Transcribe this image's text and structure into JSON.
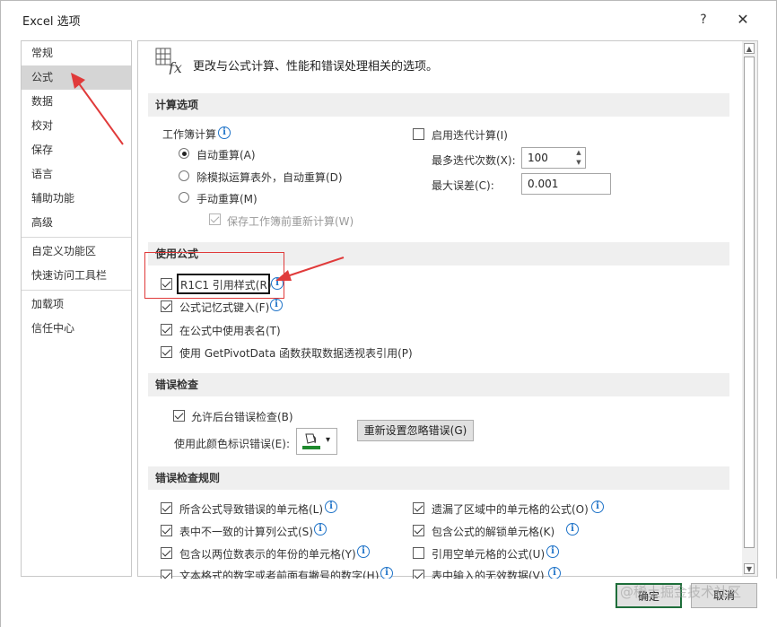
{
  "window": {
    "title": "Excel 选项",
    "help_label": "?",
    "close_label": "✕"
  },
  "sidebar": {
    "items": [
      {
        "label": "常规"
      },
      {
        "label": "公式",
        "selected": true
      },
      {
        "label": "数据"
      },
      {
        "label": "校对"
      },
      {
        "label": "保存"
      },
      {
        "label": "语言"
      },
      {
        "label": "辅助功能"
      },
      {
        "label": "高级"
      },
      {
        "label": "自定义功能区"
      },
      {
        "label": "快速访问工具栏"
      },
      {
        "label": "加载项"
      },
      {
        "label": "信任中心"
      }
    ]
  },
  "header": {
    "text": "更改与公式计算、性能和错误处理相关的选项。"
  },
  "calc": {
    "title": "计算选项",
    "workbook_label": "工作簿计算",
    "auto": "自动重算(A)",
    "auto_except": "除模拟运算表外，自动重算(D)",
    "manual": "手动重算(M)",
    "recalc_before_save": "保存工作簿前重新计算(W)",
    "iterative": "启用迭代计算(I)",
    "max_iter_label": "最多迭代次数(X):",
    "max_iter_value": "100",
    "max_change_label": "最大误差(C):",
    "max_change_value": "0.001"
  },
  "formulas": {
    "title": "使用公式",
    "r1c1": "R1C1 引用样式(R)",
    "autocomplete": "公式记忆式键入(F)",
    "table_names": "在公式中使用表名(T)",
    "getpivotdata": "使用 GetPivotData 函数获取数据透视表引用(P)"
  },
  "error_checking": {
    "title": "错误检查",
    "enable_bg": "允许后台错误检查(B)",
    "color_label": "使用此颜色标识错误(E):",
    "reset_button": "重新设置忽略错误(G)"
  },
  "rules": {
    "title": "错误检查规则",
    "left": [
      "所含公式导致错误的单元格(L)",
      "表中不一致的计算列公式(S)",
      "包含以两位数表示的年份的单元格(Y)",
      "文本格式的数字或者前面有撇号的数字(H)"
    ],
    "right": [
      "遗漏了区域中的单元格的公式(O)",
      "包含公式的解锁单元格(K)",
      "引用空单元格的公式(U)",
      "表中输入的无效数据(V)"
    ]
  },
  "footer": {
    "ok": "确定",
    "cancel": "取消"
  },
  "watermark": "@稀土掘金技术社区",
  "icons": {
    "info": "i",
    "up": "▲",
    "down": "▼",
    "spin_up": "▲",
    "spin_down": "▼",
    "dropdown": "▾"
  },
  "colors": {
    "accent_red": "#e03a3a",
    "info_blue": "#1f73c8",
    "selected_nav": "#d5d5d5",
    "section_bg": "#efefef"
  }
}
